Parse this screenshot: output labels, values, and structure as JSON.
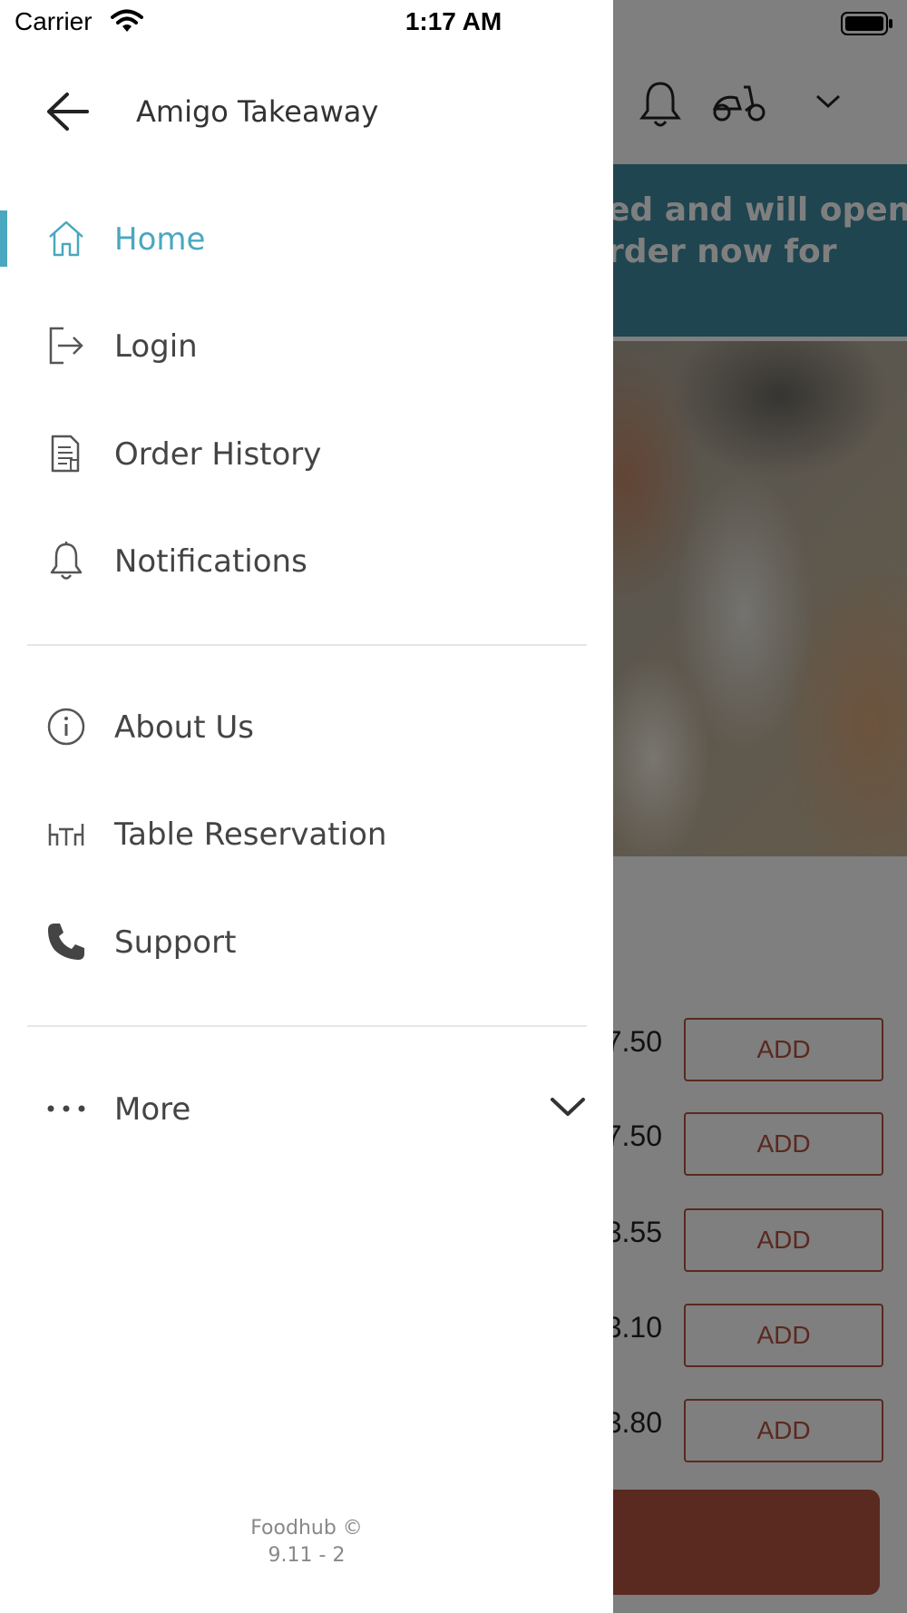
{
  "status_bar": {
    "carrier": "Carrier",
    "time": "1:17 AM"
  },
  "drawer": {
    "title": "Amigo Takeaway",
    "back_icon": "arrow-left-icon",
    "menu_primary": [
      {
        "label": "Home",
        "icon": "home-icon",
        "active": true
      },
      {
        "label": "Login",
        "icon": "login-icon",
        "active": false
      },
      {
        "label": "Order History",
        "icon": "receipt-icon",
        "active": false
      },
      {
        "label": "Notifications",
        "icon": "bell-icon",
        "active": false
      }
    ],
    "menu_secondary": [
      {
        "label": "About Us",
        "icon": "info-icon"
      },
      {
        "label": "Table Reservation",
        "icon": "table-icon"
      },
      {
        "label": "Support",
        "icon": "phone-icon"
      }
    ],
    "more": {
      "label": "More",
      "icon": "more-dots-icon"
    },
    "footer": {
      "brand": "Foodhub ©",
      "version": "9.11 - 2"
    }
  },
  "background": {
    "banner_text_line1": "ed and will open",
    "banner_text_line2": "rder now for",
    "items": [
      {
        "price": "7.50",
        "button": "ADD"
      },
      {
        "price": "7.50",
        "button": "ADD"
      },
      {
        "price": "3.55",
        "button": "ADD"
      },
      {
        "price": "3.10",
        "button": "ADD"
      },
      {
        "price": "3.80",
        "button": "ADD"
      }
    ]
  },
  "colors": {
    "accent": "#4aa7bf",
    "banner": "#3e8aa0",
    "add_button": "#b5533e",
    "scrim": "rgba(0,0,0,0.5)"
  }
}
